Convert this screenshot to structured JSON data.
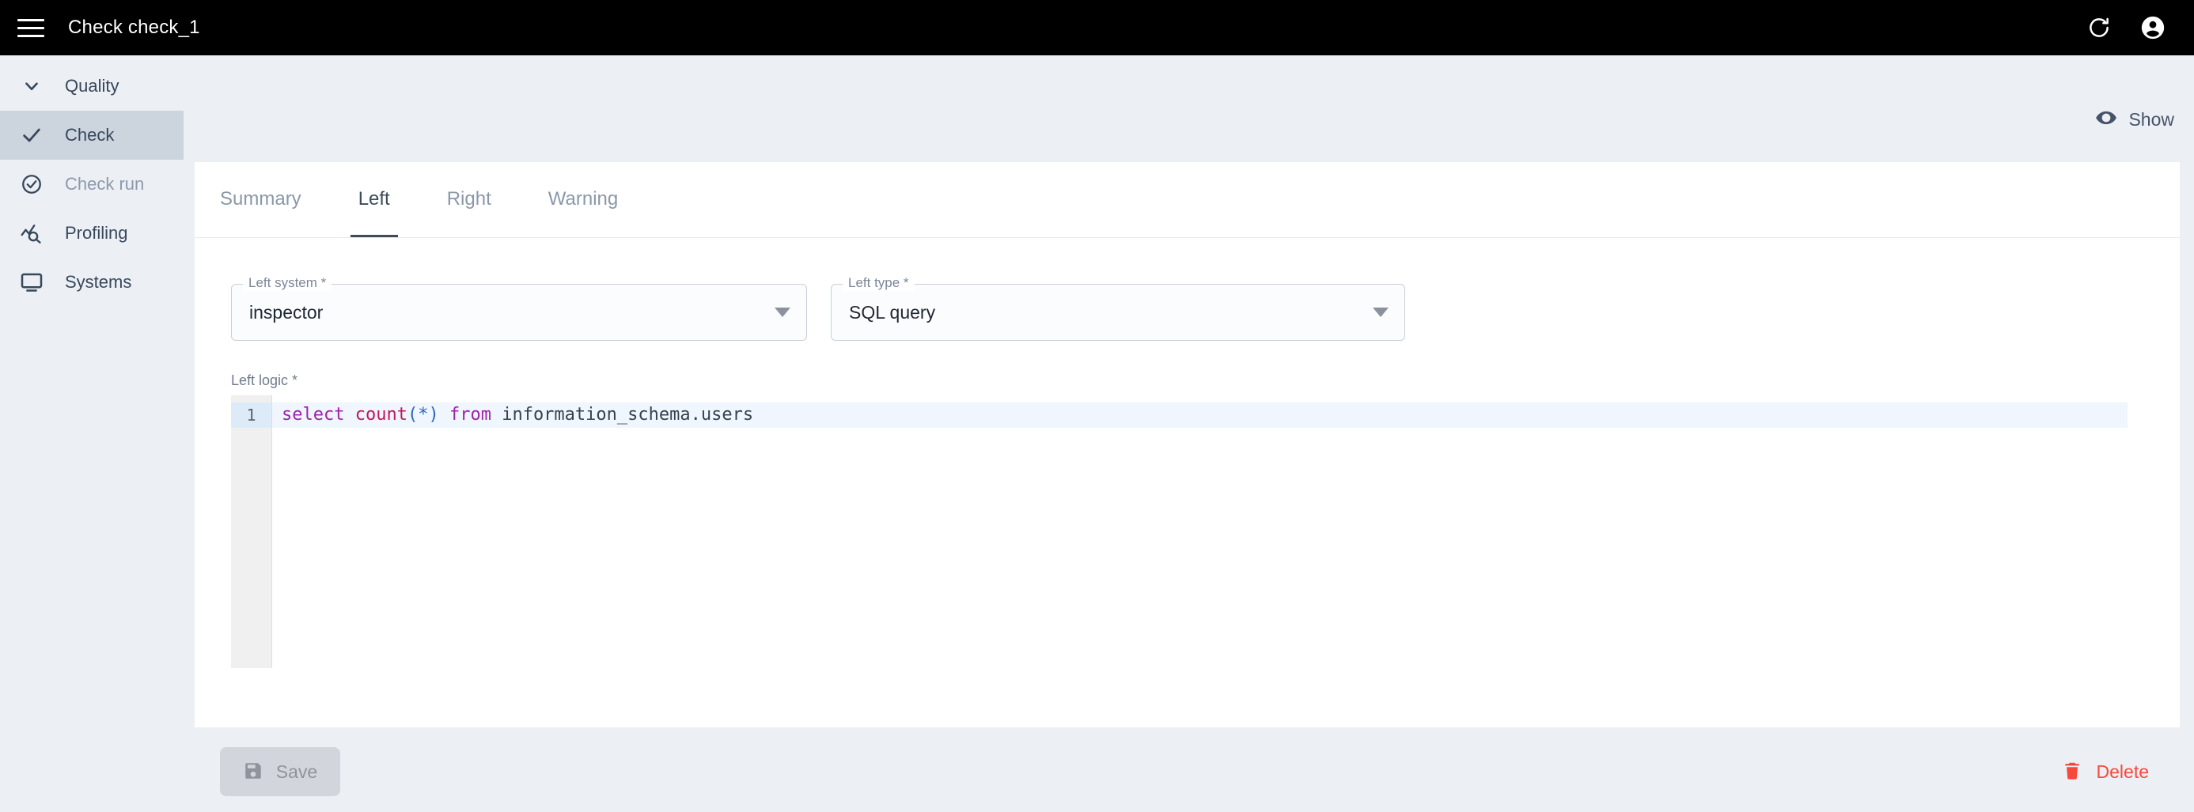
{
  "topbar": {
    "title": "Check check_1",
    "menu_icon": "hamburger-menu-icon",
    "refresh_icon": "refresh-icon",
    "account_icon": "account-circle-icon"
  },
  "sidebar": {
    "items": [
      {
        "label": "Quality",
        "icon": "chevron-down-icon",
        "active": false,
        "muted": false
      },
      {
        "label": "Check",
        "icon": "check-icon",
        "active": true,
        "muted": false
      },
      {
        "label": "Check run",
        "icon": "check-circle-icon",
        "active": false,
        "muted": true
      },
      {
        "label": "Profiling",
        "icon": "profiling-chart-icon",
        "active": false,
        "muted": false
      },
      {
        "label": "Systems",
        "icon": "monitor-icon",
        "active": false,
        "muted": false
      }
    ]
  },
  "main": {
    "show_toggle": {
      "label": "Show",
      "icon": "eye-icon"
    },
    "tabs": [
      {
        "label": "Summary",
        "active": false
      },
      {
        "label": "Left",
        "active": true
      },
      {
        "label": "Right",
        "active": false
      },
      {
        "label": "Warning",
        "active": false
      }
    ],
    "fields": {
      "left_system": {
        "label": "Left system *",
        "value": "inspector"
      },
      "left_type": {
        "label": "Left type *",
        "value": "SQL query"
      }
    },
    "editor": {
      "label": "Left logic *",
      "line_number": "1",
      "tokens": [
        {
          "text": "select",
          "kind": "keyword"
        },
        {
          "text": " ",
          "kind": "plain"
        },
        {
          "text": "count",
          "kind": "function"
        },
        {
          "text": "(",
          "kind": "paren"
        },
        {
          "text": "*",
          "kind": "operator"
        },
        {
          "text": ")",
          "kind": "paren"
        },
        {
          "text": " ",
          "kind": "plain"
        },
        {
          "text": "from",
          "kind": "keyword"
        },
        {
          "text": " ",
          "kind": "plain"
        },
        {
          "text": "information_schema.users",
          "kind": "identifier"
        }
      ],
      "full_text": "select count(*) from information_schema.users"
    },
    "footer": {
      "save": {
        "label": "Save",
        "icon": "save-floppy-icon",
        "disabled": true
      },
      "delete": {
        "label": "Delete",
        "icon": "trash-icon",
        "disabled": false
      }
    }
  },
  "colors": {
    "topbar_bg": "#000000",
    "page_bg": "#eceff4",
    "card_bg": "#ffffff",
    "sidebar_active_bg": "#ccd4de",
    "text_primary": "#37485c",
    "text_muted": "#8d9aab",
    "tab_active": "#3d4b5c",
    "delete_red": "#f7493a",
    "save_disabled_bg": "#d2d6dc",
    "editor_active_line": "#eff6fd",
    "gutter_bg": "#f0f0f0",
    "gutter_active": "#ddebf9",
    "sql_keyword": "#a020b0",
    "sql_function": "#c2185b",
    "sql_paren": "#3166c4",
    "sql_identifier": "#374151"
  }
}
